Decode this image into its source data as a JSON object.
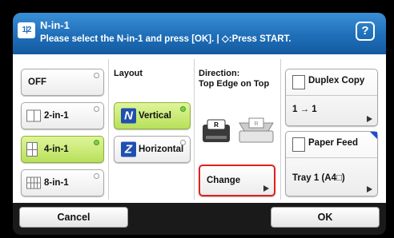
{
  "header": {
    "mode_icon": "1|2",
    "title": "N-in-1",
    "subtitle": "Please select the N-in-1 and press [OK]. | ◇:Press START.",
    "help_label": "?"
  },
  "options": {
    "off": "OFF",
    "two_in_one": "2-in-1",
    "four_in_one": "4-in-1",
    "eight_in_one": "8-in-1",
    "selected": "4-in-1"
  },
  "layout": {
    "heading": "Layout",
    "vertical": "Vertical",
    "horizontal": "Horizontal",
    "selected": "Vertical"
  },
  "direction": {
    "heading_line1": "Direction:",
    "heading_line2": "Top Edge on Top",
    "change_label": "Change"
  },
  "duplex": {
    "title": "Duplex Copy",
    "value": "1 → 1"
  },
  "paper": {
    "title": "Paper Feed",
    "value": "Tray 1 (A4□)"
  },
  "footer": {
    "cancel": "Cancel",
    "ok": "OK"
  },
  "colors": {
    "header_blue": "#1f6fb8",
    "selected_green": "#b8e05a",
    "highlight_red": "#e02020"
  }
}
